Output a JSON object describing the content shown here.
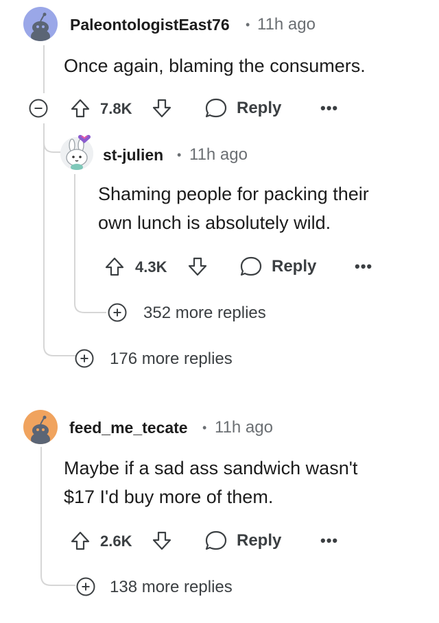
{
  "comments": [
    {
      "username": "PaleontologistEast76",
      "time": "11h ago",
      "body_lines": [
        "Once again, blaming the consumers."
      ],
      "votes": "7.8K",
      "reply_label": "Reply",
      "more_replies": "176 more replies",
      "avatar_color": "#9aa7e8",
      "reply": {
        "username": "st-julien",
        "time": "11h ago",
        "body_lines": [
          "Shaming people for packing their",
          "own lunch is absolutely wild."
        ],
        "votes": "4.3K",
        "reply_label": "Reply",
        "more_replies": "352 more replies"
      }
    },
    {
      "username": "feed_me_tecate",
      "time": "11h ago",
      "body_lines": [
        "Maybe if a sad ass sandwich wasn't",
        "$17 I'd buy more of them."
      ],
      "votes": "2.6K",
      "reply_label": "Reply",
      "more_replies": "138 more replies",
      "avatar_color": "#f0a35e"
    }
  ],
  "separator": "•",
  "overflow_glyph": "•••",
  "collapse_glyph": "−",
  "expand_glyph": "+"
}
